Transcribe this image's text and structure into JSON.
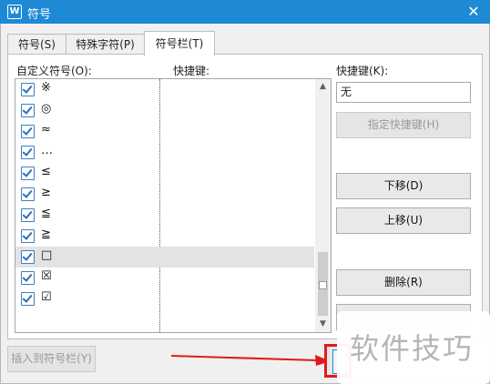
{
  "window": {
    "title": "符号",
    "app_icon": "W",
    "close_icon": "✕"
  },
  "tabs": [
    {
      "label": "符号(S)",
      "active": false
    },
    {
      "label": "特殊字符(P)",
      "active": false
    },
    {
      "label": "符号栏(T)",
      "active": true
    }
  ],
  "list": {
    "header_symbols": "自定义符号(O):",
    "header_shortcut": "快捷键:",
    "items": [
      {
        "symbol": "※",
        "checked": true,
        "selected": false
      },
      {
        "symbol": "◎",
        "checked": true,
        "selected": false
      },
      {
        "symbol": "≈",
        "checked": true,
        "selected": false
      },
      {
        "symbol": "…",
        "checked": true,
        "selected": false
      },
      {
        "symbol": "≤",
        "checked": true,
        "selected": false
      },
      {
        "symbol": "≥",
        "checked": true,
        "selected": false
      },
      {
        "symbol": "≦",
        "checked": true,
        "selected": false
      },
      {
        "symbol": "≧",
        "checked": true,
        "selected": false
      },
      {
        "symbol": "□",
        "checked": true,
        "selected": true
      },
      {
        "symbol": "☒",
        "checked": true,
        "selected": false
      },
      {
        "symbol": "☑",
        "checked": true,
        "selected": false
      }
    ]
  },
  "shortcut": {
    "label": "快捷键(K):",
    "value": "无",
    "assign_button": "指定快捷键(H)"
  },
  "buttons": {
    "move_down": "下移(D)",
    "move_up": "上移(U)",
    "delete": "删除(R)",
    "insert_to_bar": "插入到符号栏(Y)"
  },
  "watermark": "软件技巧",
  "colors": {
    "titlebar": "#1e8ad6",
    "highlight": "#e11b1b"
  }
}
